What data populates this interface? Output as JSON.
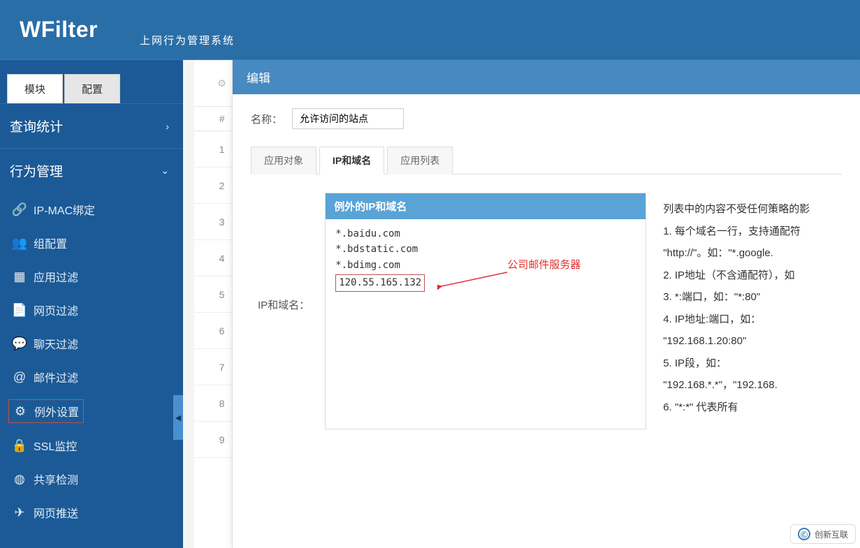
{
  "header": {
    "logo": "WFilter",
    "sub": "上网行为管理系统"
  },
  "sidebar": {
    "tabs": {
      "module": "模块",
      "config": "配置"
    },
    "sections": [
      {
        "title": "查询统计",
        "expanded": false
      },
      {
        "title": "行为管理",
        "expanded": true
      }
    ],
    "items": [
      {
        "icon": "link-icon",
        "glyph": "🔗",
        "label": "IP-MAC绑定"
      },
      {
        "icon": "group-icon",
        "glyph": "👥",
        "label": "组配置"
      },
      {
        "icon": "app-icon",
        "glyph": "▦",
        "label": "应用过滤"
      },
      {
        "icon": "page-icon",
        "glyph": "📄",
        "label": "网页过滤"
      },
      {
        "icon": "chat-icon",
        "glyph": "💬",
        "label": "聊天过滤"
      },
      {
        "icon": "mail-icon",
        "glyph": "@",
        "label": "邮件过滤"
      },
      {
        "icon": "gear-icon",
        "glyph": "⚙",
        "label": "例外设置",
        "selected": true
      },
      {
        "icon": "lock-icon",
        "glyph": "🔒",
        "label": "SSL监控"
      },
      {
        "icon": "share-icon",
        "glyph": "◍",
        "label": "共享检测"
      },
      {
        "icon": "push-icon",
        "glyph": "✈",
        "label": "网页推送"
      }
    ]
  },
  "bg_table": {
    "hash": "#",
    "rows": [
      "1",
      "2",
      "3",
      "4",
      "5",
      "6",
      "7",
      "8",
      "9"
    ]
  },
  "panel": {
    "title": "编辑",
    "name_label": "名称：",
    "name_value": "允许访问的站点",
    "tabs": [
      {
        "id": "obj",
        "label": "应用对象"
      },
      {
        "id": "ip",
        "label": "IP和域名",
        "active": true
      },
      {
        "id": "apps",
        "label": "应用列表"
      }
    ],
    "field_label": "IP和域名：",
    "inner": {
      "title": "例外的IP和域名",
      "lines": [
        "*.baidu.com",
        "*.bdstatic.com",
        "*.bdimg.com"
      ],
      "highlighted_line": "120.55.165.132",
      "annotation": "公司邮件服务器"
    },
    "help": [
      "列表中的内容不受任何策略的影",
      "1.  每个域名一行，支持通配符",
      "\"http://\"。如：\"*.google.",
      "2.  IP地址（不含通配符），如",
      "3.  *:端口，如：\"*:80\"",
      "4.  IP地址:端口，如：",
      "\"192.168.1.20:80\"",
      "5.  IP段，如：",
      "\"192.168.*.*\"，\"192.168.",
      "6.  \"*:*\" 代表所有"
    ]
  },
  "watermark": "创新互联"
}
